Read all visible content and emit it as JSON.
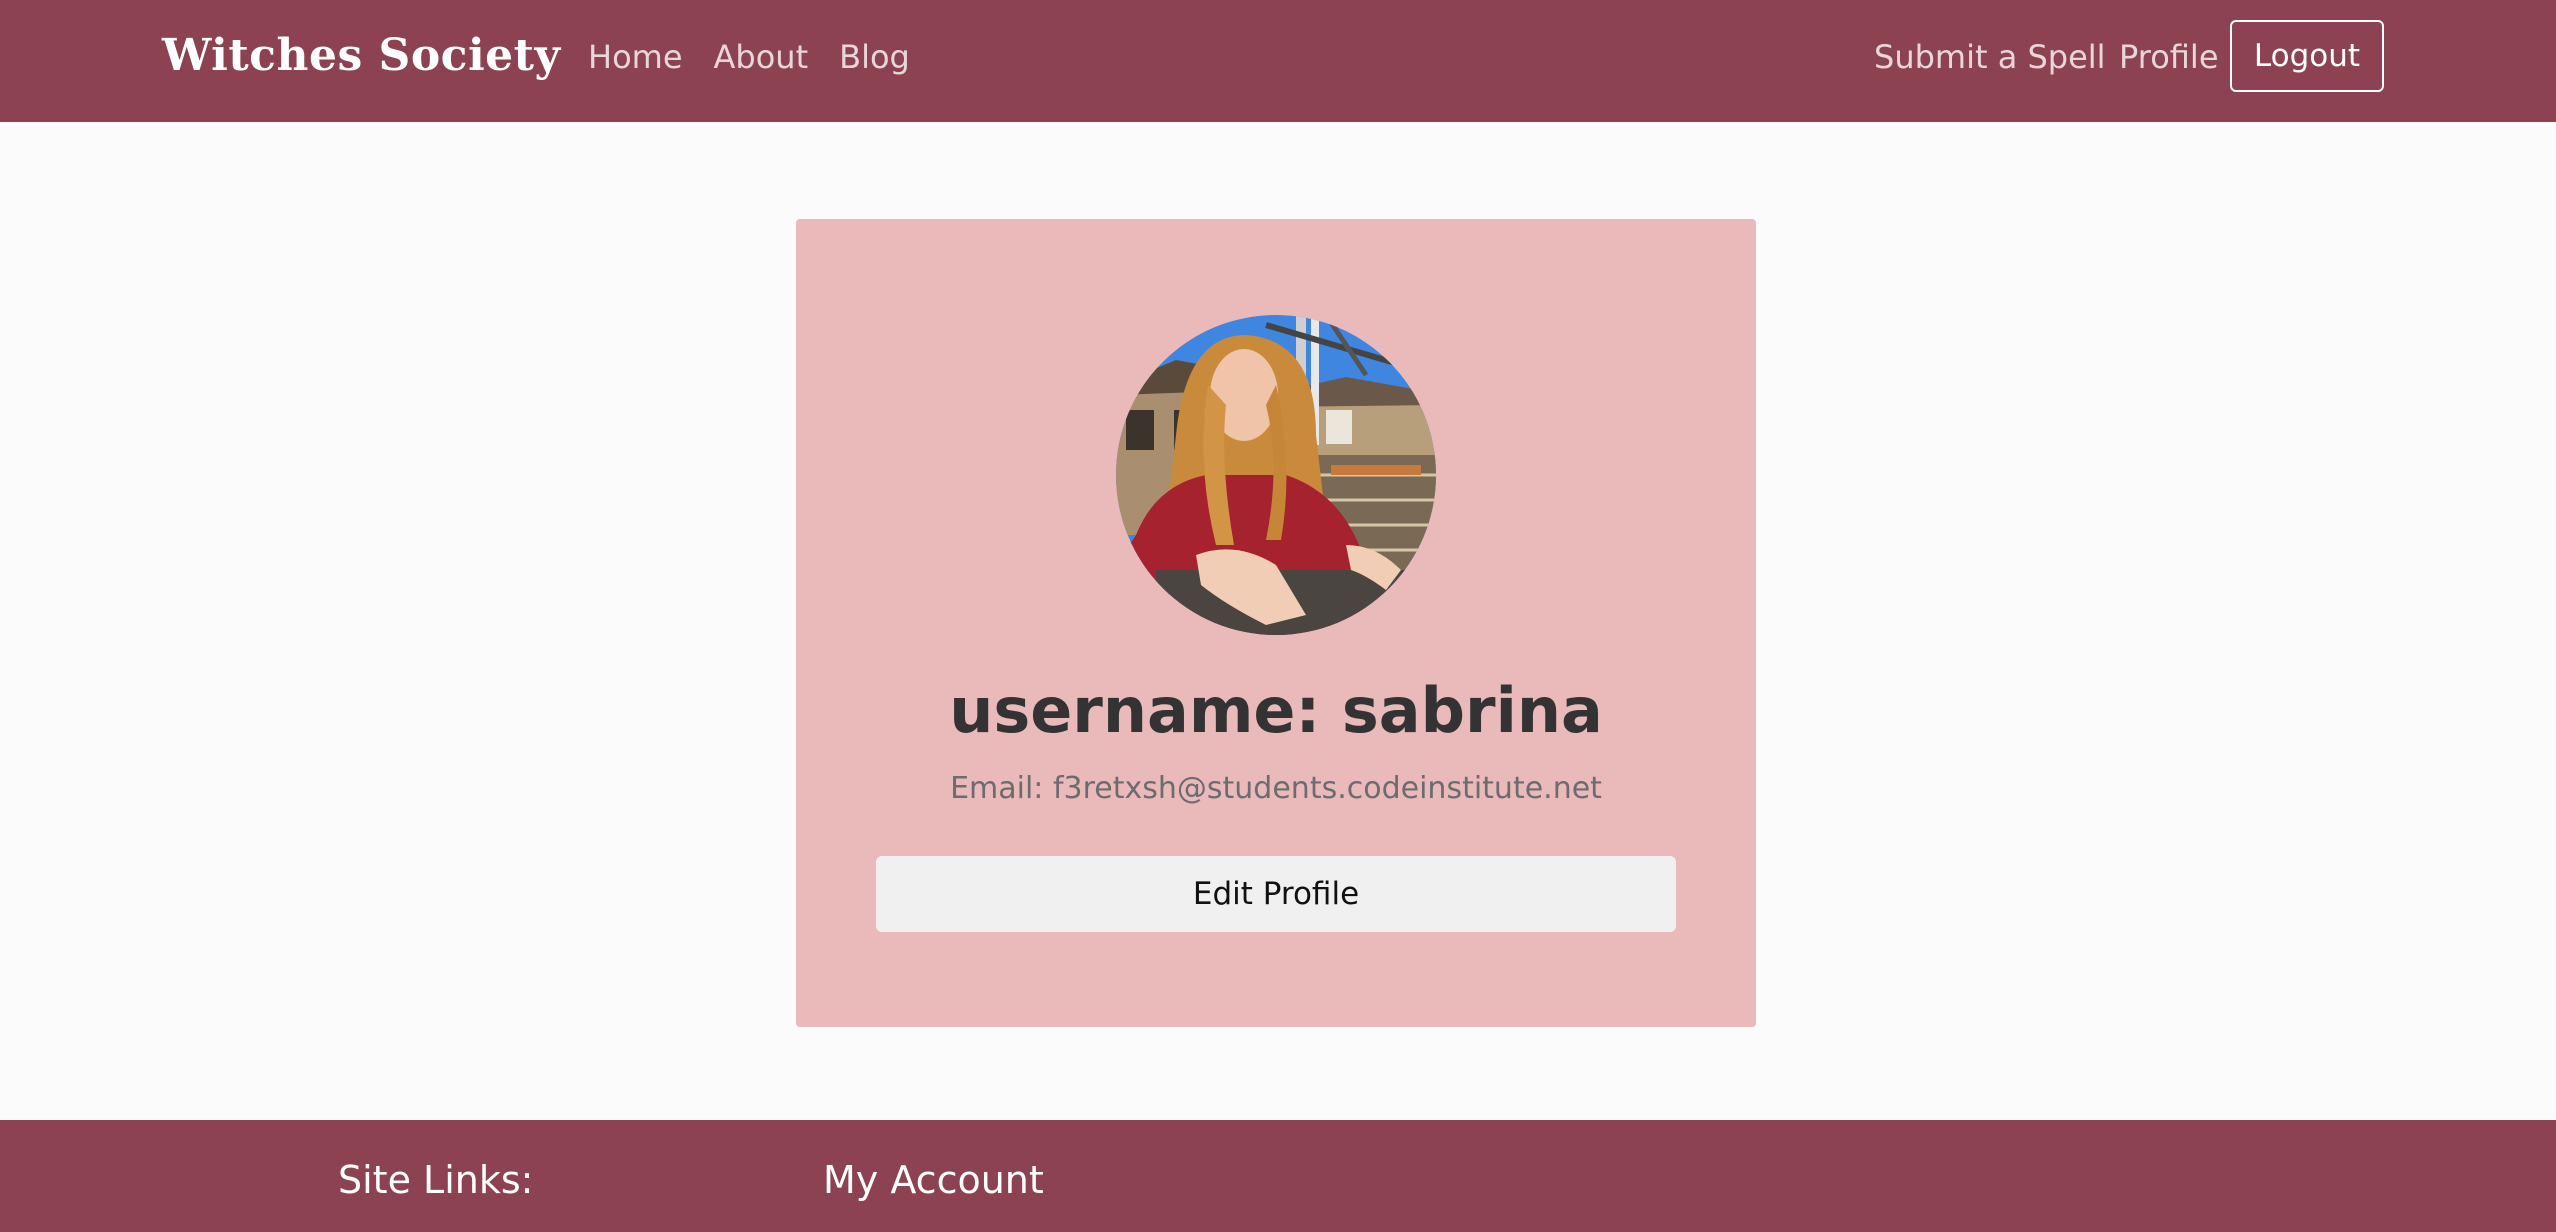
{
  "navbar": {
    "brand": "Witches Society",
    "left_links": [
      "Home",
      "About",
      "Blog"
    ],
    "submit_label": "Submit a Spell",
    "profile_label": "Profile",
    "logout_label": "Logout",
    "background": "#8c4251"
  },
  "profile": {
    "username_label": "username:",
    "username": "sabrina",
    "email_label": "Email:",
    "email": "f3retxsh@students.codeinstitute.net",
    "edit_button_label": "Edit Profile",
    "avatar_icon": "user-photo",
    "card_color": "#eababb"
  },
  "footer": {
    "site_links_heading": "Site Links:",
    "my_account_heading": "My Account"
  }
}
